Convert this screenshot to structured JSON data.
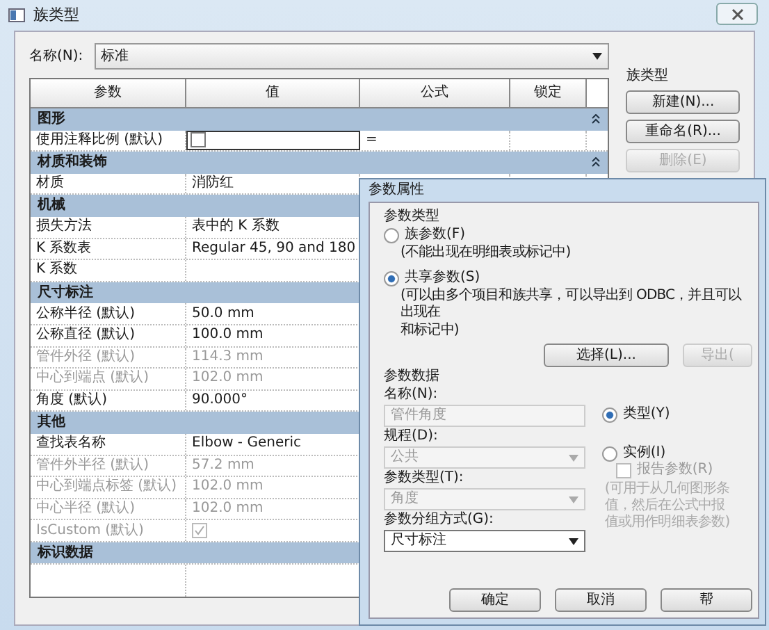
{
  "window": {
    "title": "族类型"
  },
  "name_field": {
    "label": "名称(N):",
    "value": "标准"
  },
  "table": {
    "columns": [
      "参数",
      "值",
      "公式",
      "锁定"
    ],
    "rows": [
      {
        "kind": "group",
        "label": "图形",
        "collapse": true
      },
      {
        "kind": "check",
        "name": "使用注释比例 (默认)",
        "checked": false,
        "disabled": false,
        "formula": "="
      },
      {
        "kind": "group",
        "label": "材质和装饰",
        "collapse": true
      },
      {
        "kind": "text",
        "name": "材质",
        "value": "消防红",
        "disabled": false
      },
      {
        "kind": "group",
        "label": "机械"
      },
      {
        "kind": "text",
        "name": "损失方法",
        "value": "表中的 K 系数",
        "disabled": false
      },
      {
        "kind": "text",
        "name": "K 系数表",
        "value": "Regular 45, 90 and 180",
        "disabled": false
      },
      {
        "kind": "text",
        "name": "K 系数",
        "disabled": false
      },
      {
        "kind": "group",
        "label": "尺寸标注"
      },
      {
        "kind": "text",
        "name": "公称半径 (默认)",
        "value": "50.0 mm",
        "disabled": false
      },
      {
        "kind": "text",
        "name": "公称直径 (默认)",
        "value": "100.0 mm",
        "disabled": false
      },
      {
        "kind": "text",
        "name": "管件外径 (默认)",
        "value": "114.3 mm",
        "disabled": true
      },
      {
        "kind": "text",
        "name": "中心到端点 (默认)",
        "value": "102.0 mm",
        "disabled": true
      },
      {
        "kind": "text",
        "name": "角度 (默认)",
        "value": "90.000°",
        "disabled": false
      },
      {
        "kind": "group",
        "label": "其他"
      },
      {
        "kind": "text",
        "name": "查找表名称",
        "value": "Elbow - Generic",
        "disabled": false
      },
      {
        "kind": "text",
        "name": "管件外半径 (默认)",
        "value": "57.2 mm",
        "disabled": true
      },
      {
        "kind": "text",
        "name": "中心到端点标签 (默认)",
        "value": "102.0 mm",
        "disabled": true
      },
      {
        "kind": "text",
        "name": "中心半径 (默认)",
        "value": "102.0 mm",
        "disabled": true
      },
      {
        "kind": "check",
        "name": "IsCustom (默认)",
        "checked": true,
        "disabled": true
      },
      {
        "kind": "group",
        "label": "标识数据"
      }
    ]
  },
  "family_types": {
    "title": "族类型",
    "buttons": [
      {
        "label": "新建(N)...",
        "disabled": false
      },
      {
        "label": "重命名(R)...",
        "disabled": false
      },
      {
        "label": "删除(E)",
        "disabled": true
      }
    ]
  },
  "dialog": {
    "title": "参数属性",
    "type_group": {
      "title": "参数类型",
      "options": [
        {
          "label": "族参数(F)",
          "note": [
            "(不能出现在明细表或标记中)"
          ],
          "selected": false
        },
        {
          "label": "共享参数(S)",
          "note": [
            "(可以由多个项目和族共享，可以导出到 ODBC，并且可以出现在",
            "和标记中)"
          ],
          "selected": true
        }
      ],
      "buttons": [
        {
          "label": "选择(L)...",
          "disabled": false
        },
        {
          "label": "导出(",
          "disabled": true
        }
      ]
    },
    "data_title": "参数数据",
    "fields": [
      {
        "label": "名称(N):",
        "value": "管件角度",
        "kind": "input",
        "disabled": true
      },
      {
        "label": "规程(D):",
        "value": "公共",
        "kind": "select",
        "disabled": true
      },
      {
        "label": "参数类型(T):",
        "value": "角度",
        "kind": "select",
        "disabled": true
      },
      {
        "label": "参数分组方式(G):",
        "value": "尺寸标注",
        "kind": "select",
        "disabled": false
      }
    ],
    "scope": [
      {
        "label": "类型(Y)",
        "selected": true
      },
      {
        "label": "实例(I)",
        "selected": false
      }
    ],
    "report": {
      "label": "报告参数(R)",
      "checked": false,
      "disabled": true,
      "note": [
        "(可用于从几何图形条",
        "值，然后在公式中报",
        "值或用作明细表参数)"
      ]
    },
    "buttons": [
      "确定",
      "取消",
      "帮"
    ]
  }
}
